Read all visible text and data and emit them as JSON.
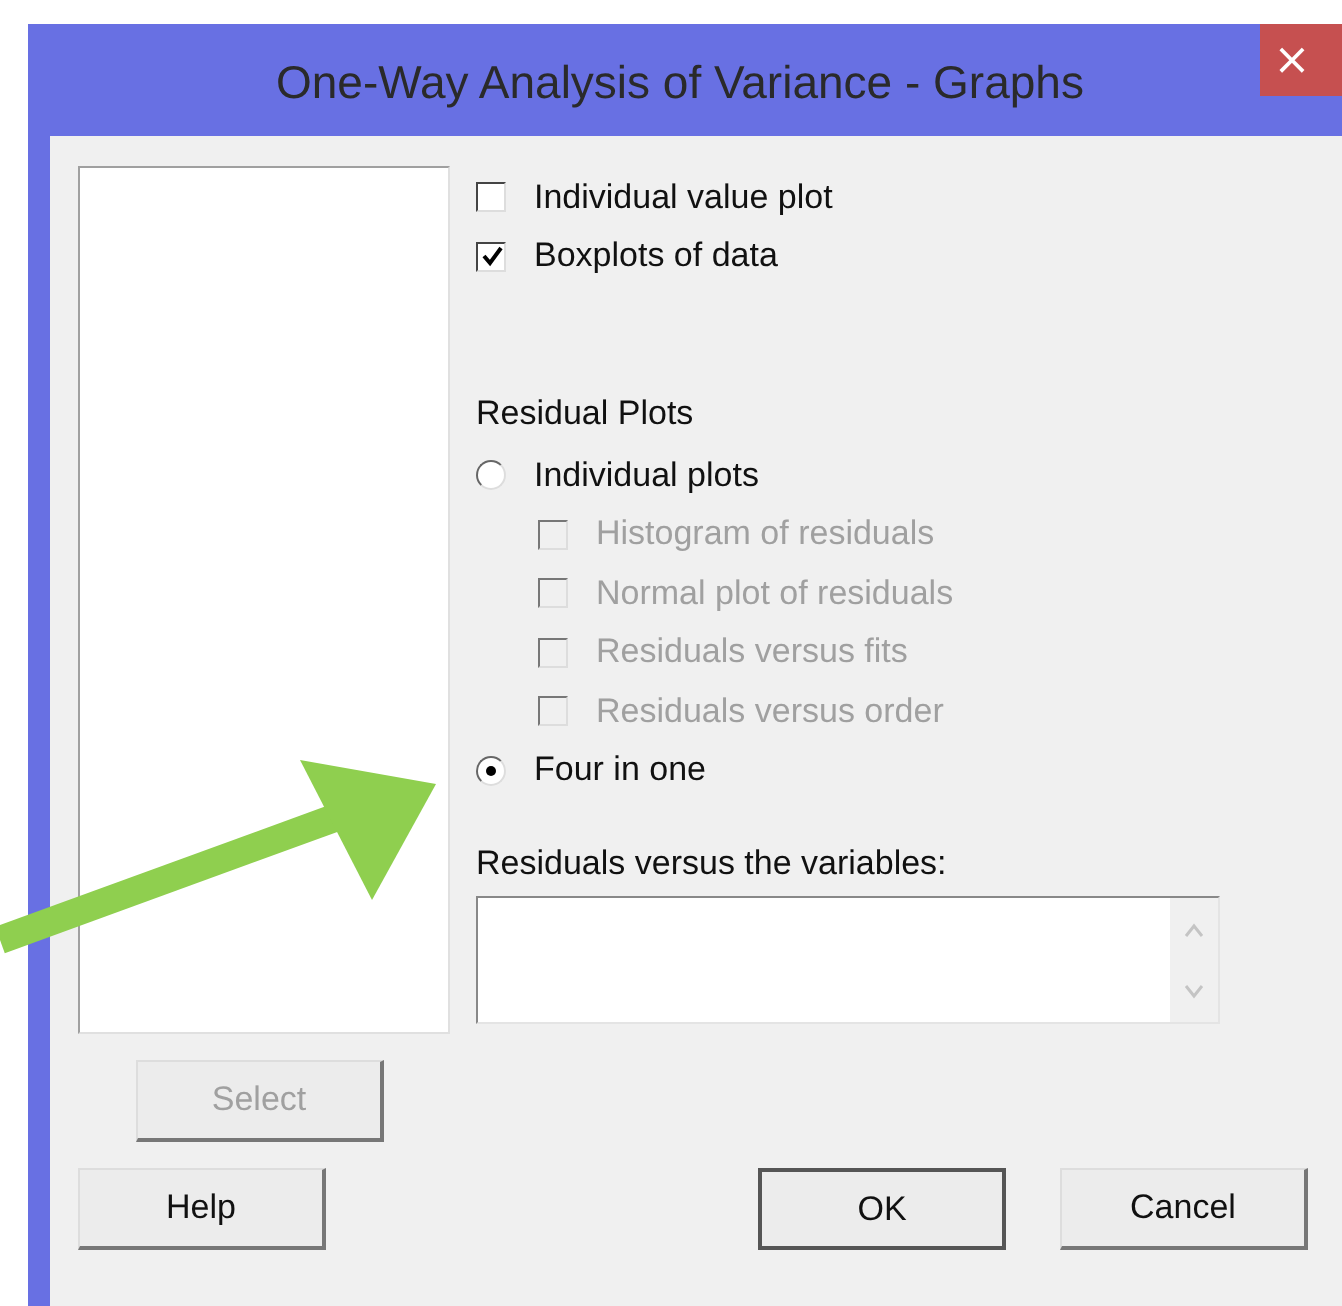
{
  "window": {
    "title": "One-Way Analysis of Variance - Graphs",
    "close": "×"
  },
  "graph_options": [
    {
      "label": "Individual value plot",
      "checked": false
    },
    {
      "label": "Boxplots of data",
      "checked": true
    }
  ],
  "residual_plots": {
    "label": "Residual Plots",
    "options": [
      {
        "label": "Individual plots",
        "selected": false,
        "children": [
          {
            "label": "Histogram of residuals",
            "checked": false,
            "disabled": true
          },
          {
            "label": "Normal plot of residuals",
            "checked": false,
            "disabled": true
          },
          {
            "label": "Residuals versus fits",
            "checked": false,
            "disabled": true
          },
          {
            "label": "Residuals versus order",
            "checked": false,
            "disabled": true
          }
        ]
      },
      {
        "label": "Four in one",
        "selected": true
      }
    ]
  },
  "variables_field": {
    "label": "Residuals versus the variables:"
  },
  "select_button": {
    "label": "Select",
    "disabled": true
  },
  "buttons": [
    {
      "label": "Help",
      "disabled": false
    },
    {
      "label": "OK",
      "disabled": false
    },
    {
      "label": "Cancel",
      "disabled": false
    }
  ]
}
